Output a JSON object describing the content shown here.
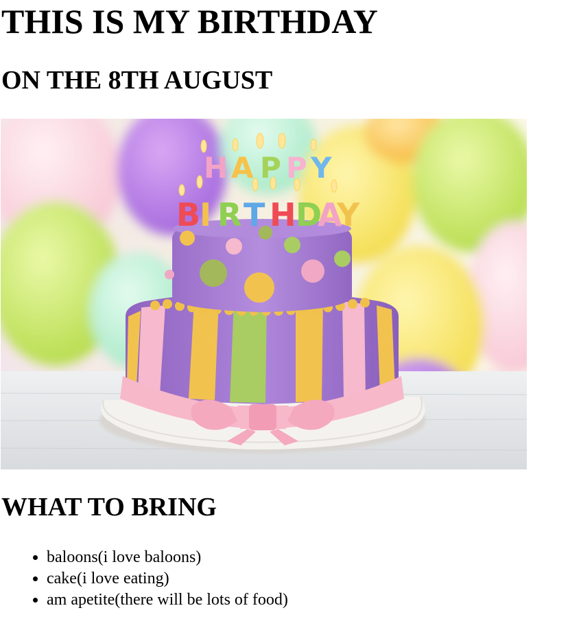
{
  "page": {
    "title": "THIS IS MY BIRTHDAY",
    "subtitle": "ON THE 8TH AUGUST"
  },
  "photo": {
    "subject": "birthday-cake-photo",
    "cake_text": {
      "line1": [
        "H",
        "A",
        "P",
        "P",
        "Y"
      ],
      "line2": [
        "B",
        "I",
        "R",
        "T",
        "H",
        "D",
        "A",
        "Y"
      ]
    },
    "colors": {
      "cake_purple": "#a87fd0",
      "stripe_yellow": "#f2c24f",
      "stripe_green": "#a9cc63",
      "bow_pink": "#f6b9cd",
      "plate_white": "#f4f2ef"
    }
  },
  "bring": {
    "heading": "WHAT TO BRING",
    "items": [
      "baloons(i love baloons)",
      "cake(i love eating)",
      "am apetite(there will be lots of food)"
    ]
  }
}
